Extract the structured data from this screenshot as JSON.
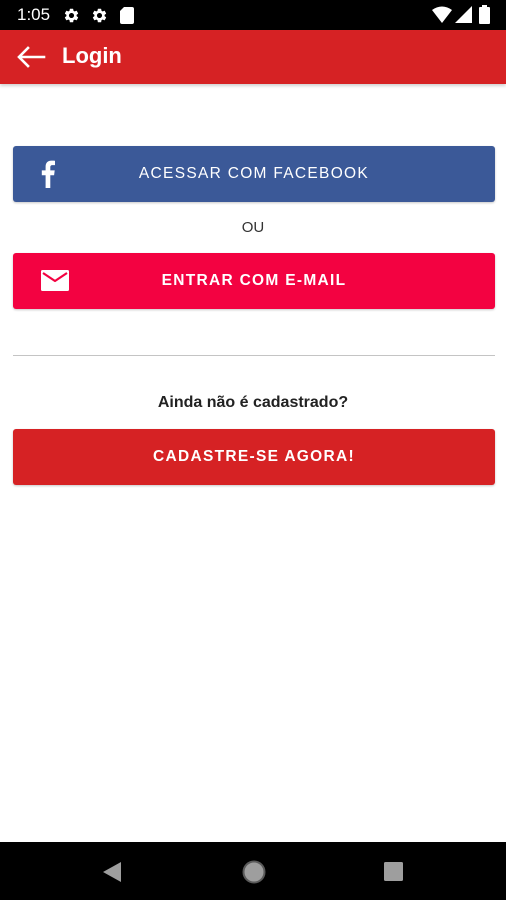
{
  "status_bar": {
    "time": "1:05",
    "icons": [
      "settings-icon",
      "settings-icon",
      "sd-card-icon",
      "wifi-icon",
      "signal-icon",
      "battery-icon"
    ]
  },
  "app_bar": {
    "title": "Login",
    "back_icon": "arrow-back-icon",
    "color": "#d62224"
  },
  "login": {
    "facebook_label": "ACESSAR COM FACEBOOK",
    "facebook_color": "#3b5998",
    "or_label": "OU",
    "email_label": "ENTRAR COM E-MAIL",
    "email_color": "#f30241"
  },
  "signup": {
    "prompt": "Ainda não é cadastrado?",
    "button_label": "CADASTRE-SE AGORA!",
    "button_color": "#d62224"
  },
  "nav_bar": {
    "icons": [
      "back-triangle-icon",
      "home-circle-icon",
      "recents-square-icon"
    ]
  }
}
